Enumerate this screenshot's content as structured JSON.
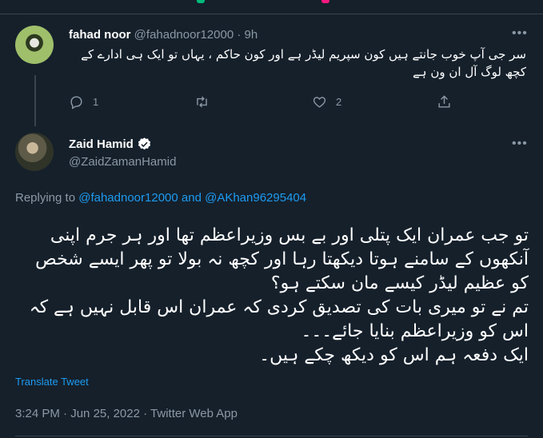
{
  "reply_tweet": {
    "name": "fahad noor",
    "handle": "@fahadnoor12000",
    "separator": "·",
    "time": "9h",
    "text": "سر جی آپ خوب جانتے ہیں کون سپریم لیڈر ہے اور کون حاکم ، یہاں تو ایک ہی ادارے کے کچھ لوگ آل ان ون ہے",
    "reply_count": "1",
    "like_count": "2"
  },
  "main_tweet": {
    "name": "Zaid Hamid",
    "handle": "@ZaidZamanHamid",
    "replying_prefix": "Replying to",
    "replying_user1": "@fahadnoor12000",
    "replying_and": "and",
    "replying_user2": "@AKhan96295404",
    "text": "تو جب عمران ایک پتلی اور بے بس وزیراعظم تھا اور ہر جرم اپنی آنکھوں کے سامنے ہوتا دیکھتا رہا اور کچھ نہ بولا تو پھر ایسے شخص کو عظیم لیڈر کیسے مان سکتے ہو؟\nتم نے تو میری بات کی تصدیق کردی کہ عمران اس قابل نہیں ہے کہ اس کو وزیراعظم بنایا جائے۔۔۔\nایک دفعہ ہم اس کو دیکھ چکے ہیں۔",
    "translate_label": "Translate Tweet",
    "time": "3:24 PM",
    "date": "Jun 25, 2022",
    "source": "Twitter Web App",
    "separator": "·"
  },
  "colors": {
    "background": "#15202b",
    "accent": "#1d9bf0",
    "secondary_text": "#8b98a5",
    "divider": "#38444d"
  },
  "icons": [
    "more-horizontal-icon",
    "reply-icon",
    "retweet-icon",
    "like-icon",
    "share-icon",
    "verified-badge-icon"
  ]
}
